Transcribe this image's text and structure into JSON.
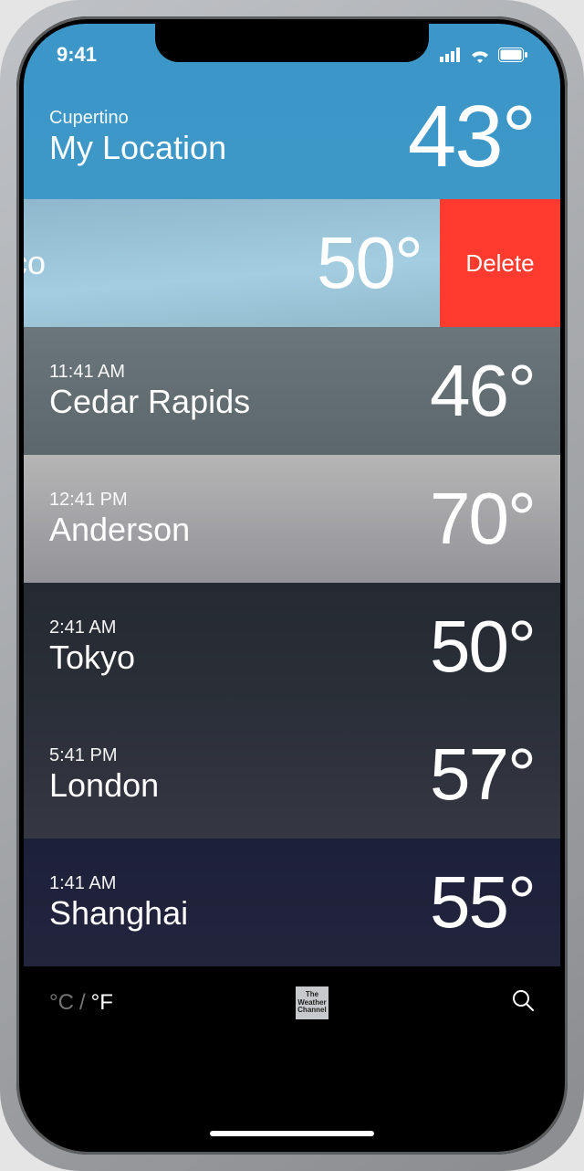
{
  "status": {
    "time": "9:41"
  },
  "locations": [
    {
      "time": "Cupertino",
      "city": "My Location",
      "temp": "43°",
      "bg": "bg-blue",
      "primary": true
    },
    {
      "time": "",
      "city": "rancisco",
      "temp": "50°",
      "bg": "bg-sky",
      "swiped": true,
      "delete": "Delete"
    },
    {
      "time": "11:41 AM",
      "city": "Cedar Rapids",
      "temp": "46°",
      "bg": "bg-rain"
    },
    {
      "time": "12:41 PM",
      "city": "Anderson",
      "temp": "70°",
      "bg": "bg-cloud"
    },
    {
      "time": "2:41 AM",
      "city": "Tokyo",
      "temp": "50°",
      "bg": "bg-dark"
    },
    {
      "time": "5:41 PM",
      "city": "London",
      "temp": "57°",
      "bg": "bg-dusk"
    },
    {
      "time": "1:41 AM",
      "city": "Shanghai",
      "temp": "55°",
      "bg": "bg-night"
    }
  ],
  "toolbar": {
    "celsius": "°C",
    "slash": "/",
    "fahrenheit": "°F",
    "twc1": "The",
    "twc2": "Weather",
    "twc3": "Channel"
  }
}
